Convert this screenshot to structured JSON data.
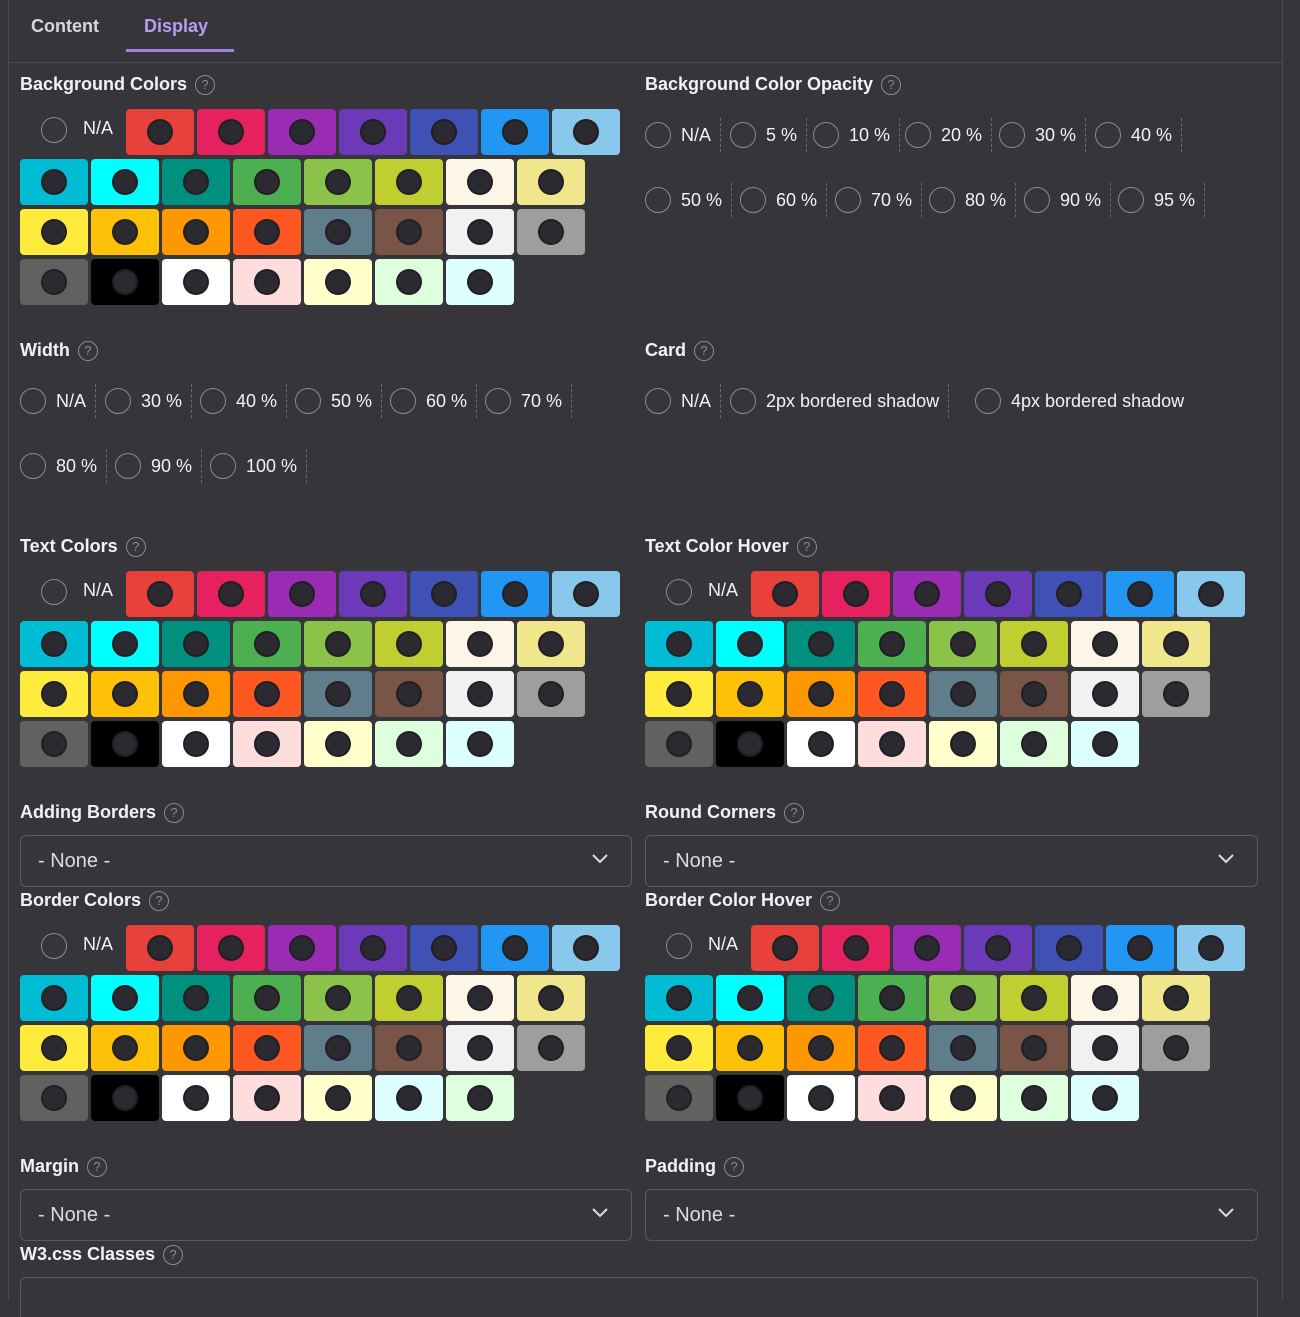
{
  "tabs": [
    {
      "label": "Content",
      "active": false
    },
    {
      "label": "Display",
      "active": true
    }
  ],
  "colors": {
    "row1": [
      "#e8403a",
      "#e6215f",
      "#9a2cb3",
      "#6a3ab8",
      "#3f51b5",
      "#2196f3",
      "#87c8ec"
    ],
    "row2": [
      "#00bcd4",
      "#00ffff",
      "#009080",
      "#4caf50",
      "#8bc34a",
      "#c0cf2f",
      "#fdf5e6",
      "#f0e68c"
    ],
    "row3": [
      "#ffeb3b",
      "#ffc107",
      "#ff9800",
      "#ff5722",
      "#607d8b",
      "#795548",
      "#f1f1f1",
      "#9e9e9e"
    ],
    "row4_a": [
      "#616161",
      "#000000",
      "#ffffff",
      "#ffdddd",
      "#ffffcc",
      "#ddffdd",
      "#ddffff"
    ],
    "row4_b": [
      "#616161",
      "#000000",
      "#ffffff",
      "#ffdddd",
      "#ffffcc",
      "#ddffff",
      "#ddffdd"
    ]
  },
  "sections": {
    "bg_colors": {
      "label": "Background Colors",
      "na": "N/A"
    },
    "bg_opacity": {
      "label": "Background Color Opacity",
      "row1": [
        "N/A",
        "5 %",
        "10 %",
        "20 %",
        "30 %",
        "40 %"
      ],
      "row2": [
        "50 %",
        "60 %",
        "70 %",
        "80 %",
        "90 %",
        "95 %"
      ]
    },
    "width": {
      "label": "Width",
      "row1": [
        "N/A",
        "30 %",
        "40 %",
        "50 %",
        "60 %",
        "70 %"
      ],
      "row2": [
        "80 %",
        "90 %",
        "100 %"
      ]
    },
    "card": {
      "label": "Card",
      "options": [
        "N/A",
        "2px bordered shadow",
        "4px bordered shadow"
      ]
    },
    "text_colors": {
      "label": "Text Colors",
      "na": "N/A"
    },
    "text_hover": {
      "label": "Text Color Hover",
      "na": "N/A"
    },
    "adding_borders": {
      "label": "Adding Borders",
      "value": "- None -"
    },
    "round_corners": {
      "label": "Round Corners",
      "value": "- None -"
    },
    "border_colors": {
      "label": "Border Colors",
      "na": "N/A"
    },
    "border_hover": {
      "label": "Border Color Hover",
      "na": "N/A"
    },
    "margin": {
      "label": "Margin",
      "value": "- None -"
    },
    "padding": {
      "label": "Padding",
      "value": "- None -"
    },
    "w3_classes": {
      "label": "W3.css Classes",
      "value": ""
    }
  },
  "icons": {
    "help": "?",
    "help_icon": "question-circle-icon",
    "chevron_icon": "chevron-down-icon"
  }
}
